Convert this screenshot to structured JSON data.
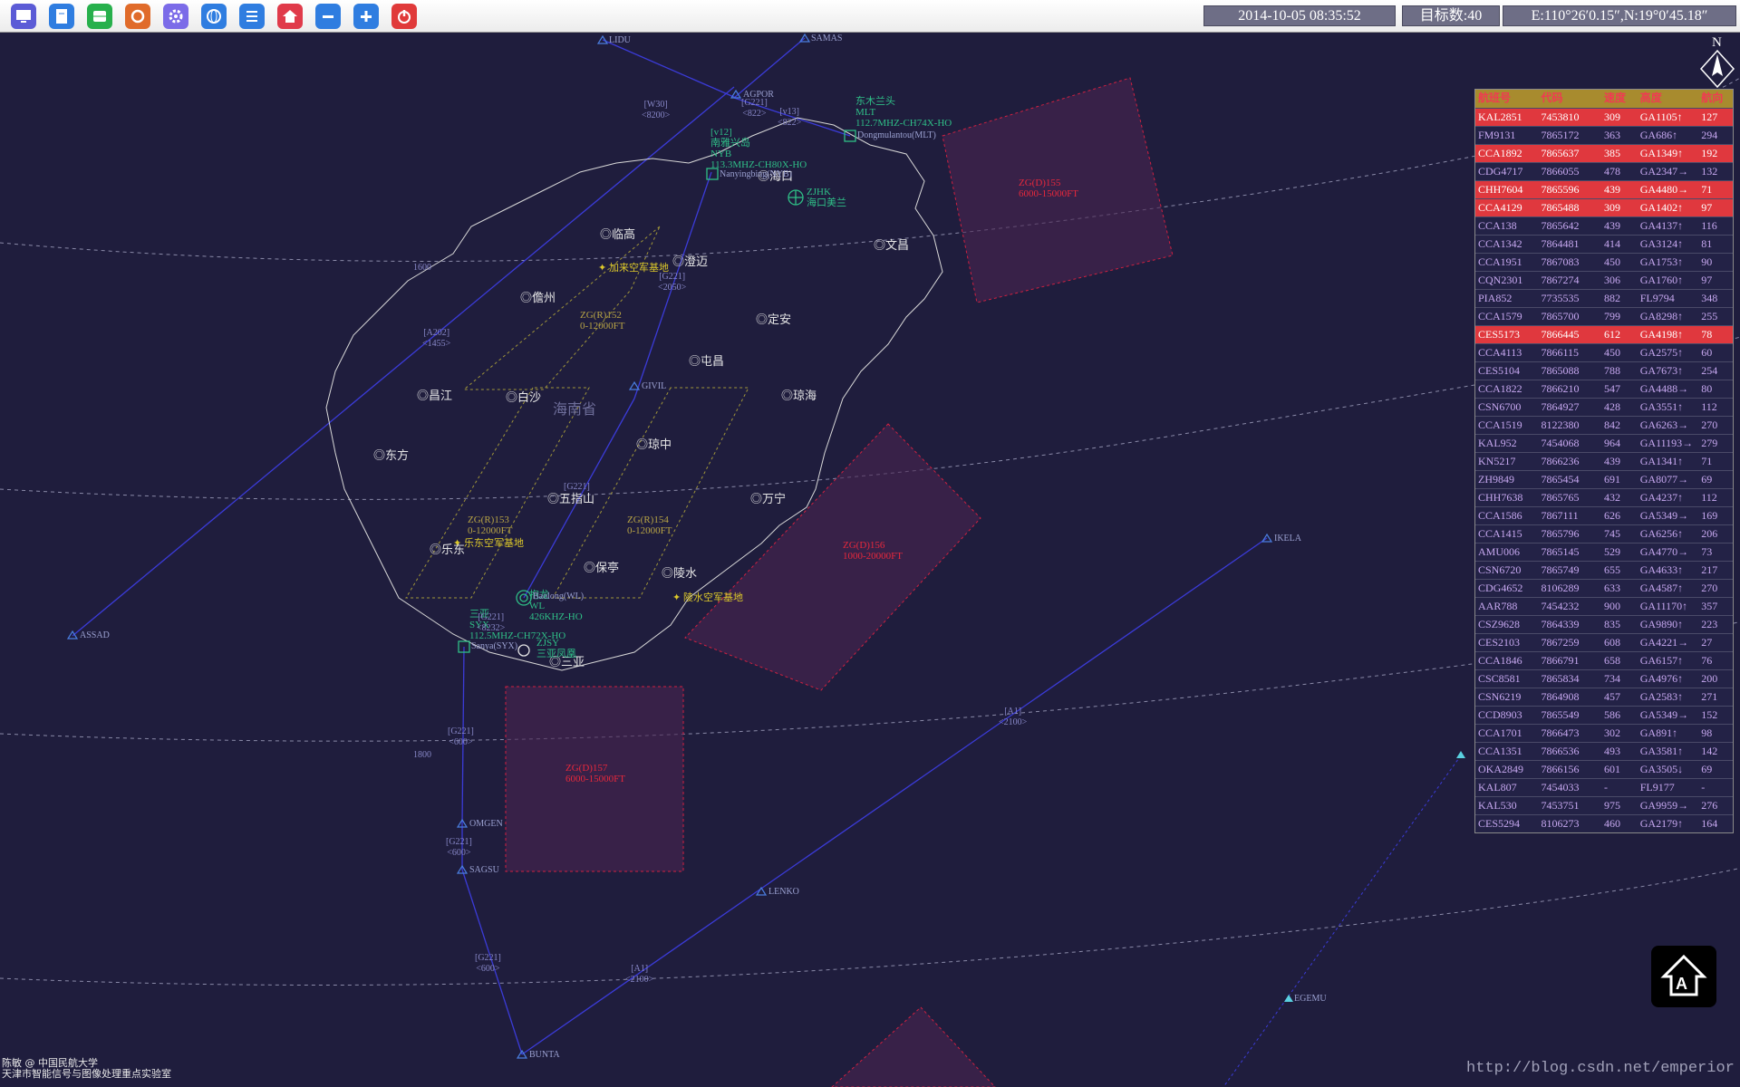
{
  "toolbar": {
    "buttons": [
      {
        "name": "monitor-icon",
        "color": "#5b5bd6"
      },
      {
        "name": "document-icon",
        "color": "#2f7de0"
      },
      {
        "name": "database-icon",
        "color": "#27b04c"
      },
      {
        "name": "refresh-icon",
        "color": "#e06b2a"
      },
      {
        "name": "gear-icon",
        "color": "#7b6be8"
      },
      {
        "name": "globe-icon",
        "color": "#2f7de0"
      },
      {
        "name": "list-icon",
        "color": "#2f7de0"
      },
      {
        "name": "home-icon",
        "color": "#e03a4a"
      },
      {
        "name": "zoom-out-icon",
        "color": "#2f7de0"
      },
      {
        "name": "zoom-in-icon",
        "color": "#2f7de0"
      },
      {
        "name": "power-icon",
        "color": "#e03a3a"
      }
    ],
    "datetime": "2014-10-05 08:35:52",
    "target_count": "目标数:40",
    "coords": "E:110°26′0.15″,N:19°0′45.18″"
  },
  "compass": {
    "north": "N"
  },
  "map": {
    "province": "海南省",
    "cities": [
      "临高",
      "澄迈",
      "儋州",
      "定安",
      "屯昌",
      "昌江",
      "白沙",
      "琼海",
      "东方",
      "琼中",
      "五指山",
      "万宁",
      "乐东",
      "保亭",
      "陵水",
      "三亚",
      "海口",
      "文昌"
    ],
    "zones": [
      {
        "id": "ZG(D)155",
        "alt": "6000-15000FT"
      },
      {
        "id": "ZG(D)156",
        "alt": "1000-20000FT"
      },
      {
        "id": "ZG(D)157",
        "alt": "6000-15000FT"
      },
      {
        "id": "ZG(R)152",
        "alt": "0-12000FT"
      },
      {
        "id": "ZG(R)153",
        "alt": "0-12000FT"
      },
      {
        "id": "ZG(R)154",
        "alt": "0-12000FT"
      }
    ],
    "waypoints": [
      "LIDU",
      "SAMAS",
      "AGPOR",
      "GIVIL",
      "IKELA",
      "ASSAD",
      "OMGEN",
      "SAGSU",
      "LENKO",
      "BUNTA",
      "EGEMU"
    ],
    "bases": [
      "加来空军基地",
      "乐东空军基地",
      "陵水空军基地"
    ],
    "navaids": {
      "mlt": [
        "东木兰头",
        "MLT",
        "112.7MHZ-CH74X-HO",
        "Dongmulantou(MLT)"
      ],
      "nyb": [
        "[v12]",
        "南雅兴岛",
        "NYB",
        "113.3MHZ-CH80X-HO",
        "Nanyingbing(NYB)"
      ],
      "zjhk": [
        "ZJHK",
        "海口美兰"
      ],
      "wl": [
        "抱龙",
        "WL",
        "426KHZ-HO",
        "Baolong(WL)"
      ],
      "syx": [
        "三亚",
        "SYX",
        "112.5MHZ-CH72X-HO",
        "Sanya(SYX)"
      ],
      "zjsy": [
        "ZJSY",
        "三亚凤凰"
      ]
    },
    "routes": [
      "[W30]",
      "<8200>",
      "[G221]",
      "<822>",
      "[v13]",
      "<822>",
      "[A202]",
      "<1455>",
      "[G221]",
      "<2050>",
      "[G221]",
      "[G221]",
      "<8232>",
      "[G221]",
      "<600>",
      "[G221]",
      "<600>",
      "[G221]",
      "<600>",
      "[A1]",
      "<2100>",
      "[A1]",
      "<2100>",
      "1600",
      "1800"
    ]
  },
  "table": {
    "headers": [
      "航班号",
      "代码",
      "速度",
      "高度",
      "航向"
    ],
    "rows": [
      [
        "KAL2851",
        "7453810",
        "309",
        "GA1105↑",
        "127",
        true
      ],
      [
        "FM9131",
        "7865172",
        "363",
        "GA686↑",
        "294",
        false
      ],
      [
        "CCA1892",
        "7865637",
        "385",
        "GA1349↑",
        "192",
        true
      ],
      [
        "CDG4717",
        "7866055",
        "478",
        "GA2347→",
        "132",
        false
      ],
      [
        "CHH7604",
        "7865596",
        "439",
        "GA4480→",
        "71",
        true
      ],
      [
        "CCA4129",
        "7865488",
        "309",
        "GA1402↑",
        "97",
        true
      ],
      [
        "CCA138",
        "7865642",
        "439",
        "GA4137↑",
        "116",
        false
      ],
      [
        "CCA1342",
        "7864481",
        "414",
        "GA3124↑",
        "81",
        false
      ],
      [
        "CCA1951",
        "7867083",
        "450",
        "GA1753↑",
        "90",
        false
      ],
      [
        "CQN2301",
        "7867274",
        "306",
        "GA1760↑",
        "97",
        false
      ],
      [
        "PIA852",
        "7735535",
        "882",
        "FL9794",
        "348",
        false
      ],
      [
        "CCA1579",
        "7865700",
        "799",
        "GA8298↑",
        "255",
        false
      ],
      [
        "CES5173",
        "7866445",
        "612",
        "GA4198↑",
        "78",
        true
      ],
      [
        "CCA4113",
        "7866115",
        "450",
        "GA2575↑",
        "60",
        false
      ],
      [
        "CES5104",
        "7865088",
        "788",
        "GA7673↑",
        "254",
        false
      ],
      [
        "CCA1822",
        "7866210",
        "547",
        "GA4488→",
        "80",
        false
      ],
      [
        "CSN6700",
        "7864927",
        "428",
        "GA3551↑",
        "112",
        false
      ],
      [
        "CCA1519",
        "8122380",
        "842",
        "GA6263→",
        "270",
        false
      ],
      [
        "KAL952",
        "7454068",
        "964",
        "GA11193→",
        "279",
        false
      ],
      [
        "KN5217",
        "7866236",
        "439",
        "GA1341↑",
        "71",
        false
      ],
      [
        "ZH9849",
        "7865454",
        "691",
        "GA8077→",
        "69",
        false
      ],
      [
        "CHH7638",
        "7865765",
        "432",
        "GA4237↑",
        "112",
        false
      ],
      [
        "CCA1586",
        "7867111",
        "626",
        "GA5349→",
        "169",
        false
      ],
      [
        "CCA1415",
        "7865796",
        "745",
        "GA6256↑",
        "206",
        false
      ],
      [
        "AMU006",
        "7865145",
        "529",
        "GA4770→",
        "73",
        false
      ],
      [
        "CSN6720",
        "7865749",
        "655",
        "GA4633↑",
        "217",
        false
      ],
      [
        "CDG4652",
        "8106289",
        "633",
        "GA4587↑",
        "270",
        false
      ],
      [
        "AAR788",
        "7454232",
        "900",
        "GA11170↑",
        "357",
        false
      ],
      [
        "CSZ9628",
        "7864339",
        "835",
        "GA9890↑",
        "223",
        false
      ],
      [
        "CES2103",
        "7867259",
        "608",
        "GA4221→",
        "27",
        false
      ],
      [
        "CCA1846",
        "7866791",
        "658",
        "GA6157↑",
        "76",
        false
      ],
      [
        "CSC8581",
        "7865834",
        "734",
        "GA4976↑",
        "200",
        false
      ],
      [
        "CSN6219",
        "7864908",
        "457",
        "GA2583↑",
        "271",
        false
      ],
      [
        "CCD8903",
        "7865549",
        "586",
        "GA5349→",
        "152",
        false
      ],
      [
        "CCA1701",
        "7866473",
        "302",
        "GA891↑",
        "98",
        false
      ],
      [
        "CCA1351",
        "7866536",
        "493",
        "GA3581↑",
        "142",
        false
      ],
      [
        "OKA2849",
        "7866156",
        "601",
        "GA3505↓",
        "69",
        false
      ],
      [
        "KAL807",
        "7454033",
        "-",
        "FL9177",
        "-",
        false
      ],
      [
        "KAL530",
        "7453751",
        "975",
        "GA9959→",
        "276",
        false
      ],
      [
        "CES5294",
        "8106273",
        "460",
        "GA2179↑",
        "164",
        false
      ]
    ]
  },
  "credits": [
    "陈敏 @ 中国民航大学",
    "天津市智能信号与图像处理重点实验室"
  ],
  "watermark": "http://blog.csdn.net/emperior"
}
